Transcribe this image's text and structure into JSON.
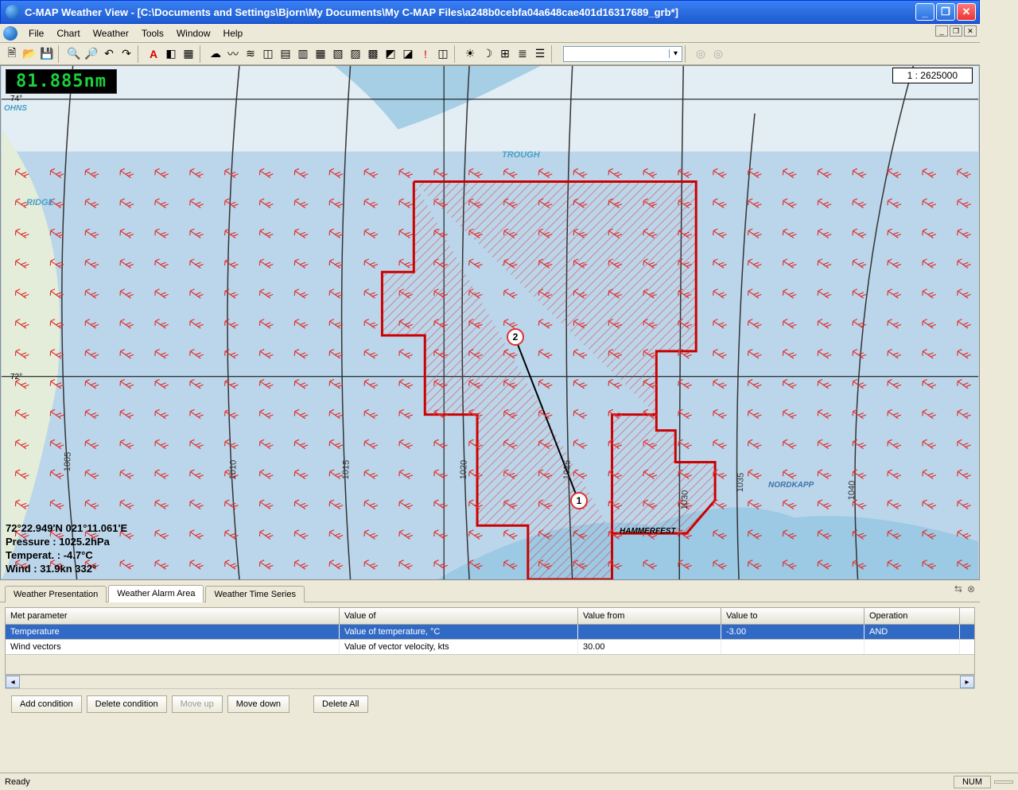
{
  "window": {
    "title": "C-MAP Weather View - [C:\\Documents and Settings\\Bjorn\\My Documents\\My C-MAP Files\\a248b0cebfa04a648cae401d16317689_grb*]"
  },
  "menus": [
    "File",
    "Chart",
    "Weather",
    "Tools",
    "Window",
    "Help"
  ],
  "toolbar": {
    "icons": [
      "new",
      "open",
      "save",
      "|",
      "zoom-in",
      "zoom-out",
      "undo",
      "redo",
      "|",
      "A-tool",
      "palette",
      "layers",
      "|",
      "wx1",
      "wx2",
      "wx3",
      "wx4",
      "wx5",
      "wx6",
      "wx7",
      "wx8",
      "wx9",
      "wx10",
      "wx11",
      "wx12",
      "alert",
      "wx13",
      "|",
      "t1",
      "t2",
      "t3",
      "t4",
      "t5",
      "|",
      "combo",
      "|",
      "circ1",
      "circ2"
    ]
  },
  "map": {
    "distance": "81.885nm",
    "scale": "1 : 2625000",
    "lat74": "74°",
    "lat72": "72°",
    "labels": {
      "ohns": "OHNS",
      "trough": "TROUGH",
      "ridge": "RIDGE",
      "nordkapp": "NORDKAPP",
      "hammerfest": "HAMMERFEST"
    },
    "isobars": {
      "i1005": "1005",
      "i1010": "1010",
      "i1015": "1015",
      "i1020": "1020",
      "i1025": "1025",
      "i1030": "1030",
      "i1035": "1035",
      "i1040": "1040"
    },
    "waypoints": {
      "wp1": "1",
      "wp2": "2"
    },
    "meteo": {
      "pos": "72°22.949'N 021°11.061'E",
      "pressure": "Pressure  : 1025.2hPa",
      "temperat": "Temperat. : -4.7°C",
      "wind": "Wind      : 31.9kn 332°"
    }
  },
  "tabs": {
    "t1": "Weather Presentation",
    "t2": "Weather Alarm Area",
    "t3": "Weather Time Series",
    "active": 1
  },
  "grid": {
    "headers": {
      "param": "Met parameter",
      "valueof": "Value of",
      "valuefrom": "Value from",
      "valueto": "Value to",
      "operation": "Operation"
    },
    "rows": [
      {
        "param": "Temperature",
        "valueof": "Value of temperature, °C",
        "valuefrom": "",
        "valueto": "-3.00",
        "operation": "AND",
        "selected": true
      },
      {
        "param": "Wind vectors",
        "valueof": "Value of vector velocity, kts",
        "valuefrom": "30.00",
        "valueto": "",
        "operation": "",
        "selected": false
      }
    ]
  },
  "buttons": {
    "add": "Add condition",
    "delete": "Delete condition",
    "moveup": "Move up",
    "movedown": "Move down",
    "deleteall": "Delete All"
  },
  "status": {
    "ready": "Ready",
    "num": "NUM"
  }
}
